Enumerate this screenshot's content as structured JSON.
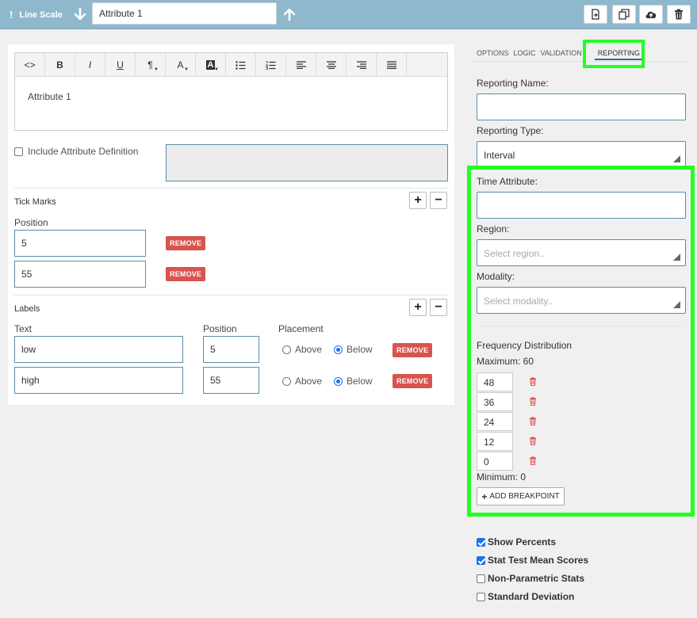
{
  "toolbar": {
    "question_type": "Line Scale",
    "attribute_name": "Attribute 1",
    "buttons": [
      "export-icon",
      "copy-icon",
      "cloud-upload-icon",
      "trash-icon"
    ]
  },
  "editor": {
    "tools": [
      "<>",
      "B",
      "I",
      "U",
      "¶",
      "A",
      "A",
      "ul-list-icon",
      "ol-list-icon",
      "align-left-icon",
      "align-center-icon",
      "align-right-icon",
      "align-justify-icon"
    ],
    "content": "Attribute 1"
  },
  "definition": {
    "checkbox_label": "Include Attribute Definition",
    "checked": false
  },
  "tick_marks": {
    "title": "Tick Marks",
    "position_header": "Position",
    "items": [
      {
        "position": "5",
        "remove": "REMOVE"
      },
      {
        "position": "55",
        "remove": "REMOVE"
      }
    ]
  },
  "labels": {
    "title": "Labels",
    "headers": {
      "text": "Text",
      "position": "Position",
      "placement": "Placement"
    },
    "above_label": "Above",
    "below_label": "Below",
    "items": [
      {
        "text": "low",
        "position": "5",
        "placement": "Below",
        "remove": "REMOVE"
      },
      {
        "text": "high",
        "position": "55",
        "placement": "Below",
        "remove": "REMOVE"
      }
    ]
  },
  "tabs": [
    "OPTIONS",
    "LOGIC",
    "VALIDATION",
    "REPORTING"
  ],
  "active_tab": "REPORTING",
  "reporting": {
    "name_label": "Reporting Name:",
    "name_value": "",
    "type_label": "Reporting Type:",
    "type_value": "Interval",
    "time_attr_label": "Time Attribute:",
    "time_attr_value": "",
    "region_label": "Region:",
    "region_placeholder": "Select region..",
    "modality_label": "Modality:",
    "modality_placeholder": "Select modality..",
    "freq_title": "Frequency Distribution",
    "maximum": "Maximum: 60",
    "breakpoints": [
      "48",
      "36",
      "24",
      "12",
      "0"
    ],
    "minimum": "Minimum: 0",
    "add_breakpoint": "ADD BREAKPOINT"
  },
  "options": [
    {
      "label": "Show Percents",
      "checked": true
    },
    {
      "label": "Stat Test Mean Scores",
      "checked": true
    },
    {
      "label": "Non-Parametric Stats",
      "checked": false
    },
    {
      "label": "Standard Deviation",
      "checked": false
    }
  ],
  "colors": {
    "topbar": "#8fb8cc",
    "remove": "#d9534f",
    "highlight": "#22ff22",
    "input_border": "#5b8da7"
  }
}
